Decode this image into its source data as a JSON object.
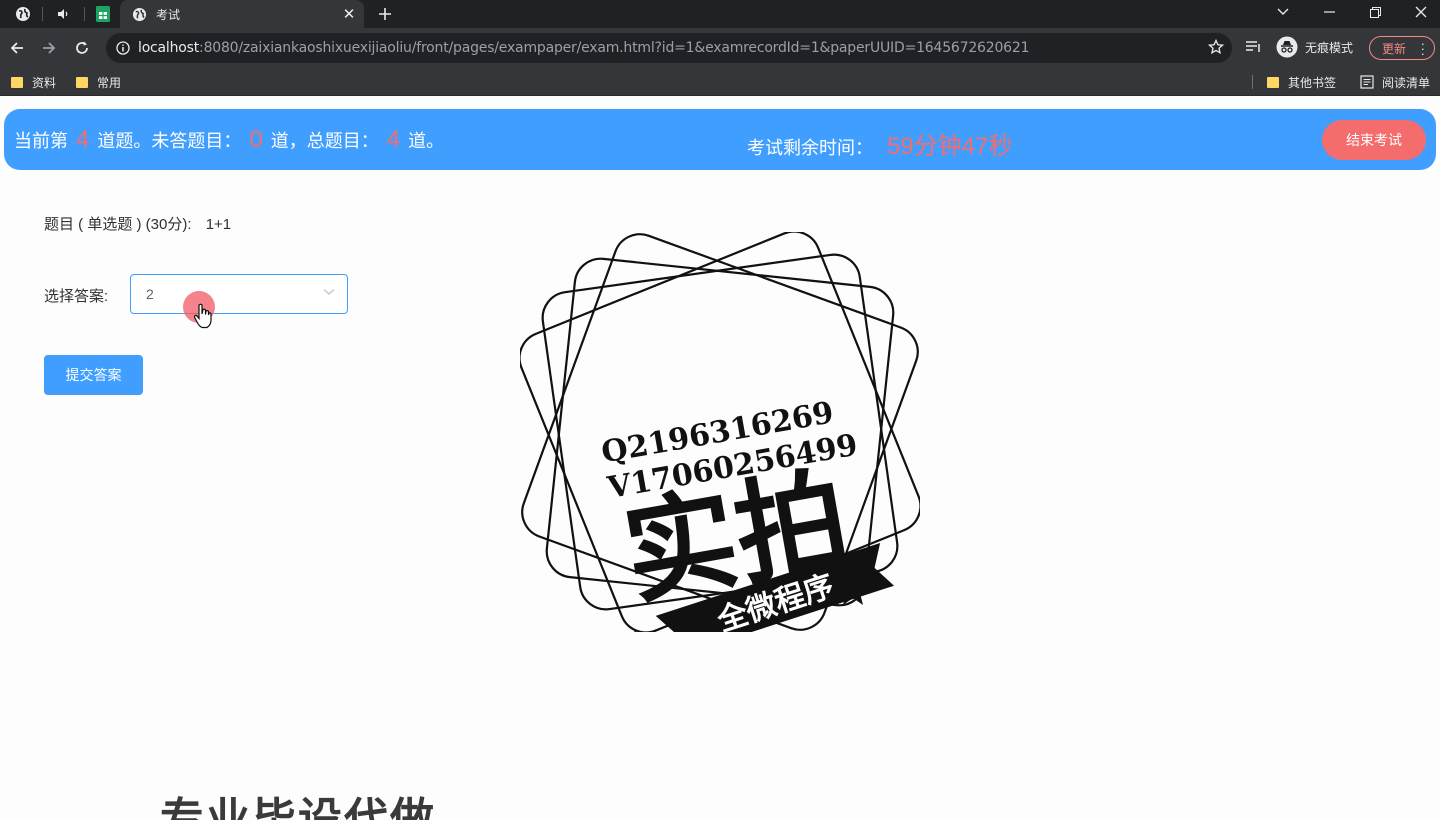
{
  "browser": {
    "tab_title": "考试",
    "url_host": "localhost",
    "url_rest": ":8080/zaixiankaoshixuexijiaoliu/front/pages/exampaper/exam.html?id=1&examrecordId=1&paperUUID=1645672620621",
    "incognito_label": "无痕模式",
    "update_label": "更新",
    "bookmarks": [
      {
        "label": "资料"
      },
      {
        "label": "常用"
      }
    ],
    "other_bookmarks": "其他书签",
    "reading_list": "阅读清单",
    "icons": {
      "pinned_tab": "globe-icon",
      "audio_tab": "speaker-icon",
      "sheet_tab": "spreadsheet-icon",
      "new_tab": "plus-icon"
    }
  },
  "exam": {
    "status": {
      "prefix": "当前第",
      "current": "4",
      "mid1": "道题。未答题目：",
      "unanswered": "0",
      "mid2": "道，总题目：",
      "total": "4",
      "suffix": "道。"
    },
    "time_label": "考试剩余时间：",
    "time_value": "59分钟47秒",
    "end_button": "结束考试",
    "question_label": "题目 ( 单选题 ) (30分):",
    "question_content": "1+1",
    "answer_label": "选择答案:",
    "selected_answer": "2",
    "submit_button": "提交答案"
  },
  "watermark": {
    "line1": "Q2196316269",
    "line2": "V17060256499",
    "main": "实拍",
    "banner": "全微程序",
    "bottom": "专业毕设代做"
  },
  "colors": {
    "primary": "#409eff",
    "danger": "#f56c6c",
    "chrome_dark": "#202124",
    "chrome_toolbar": "#35363a"
  }
}
